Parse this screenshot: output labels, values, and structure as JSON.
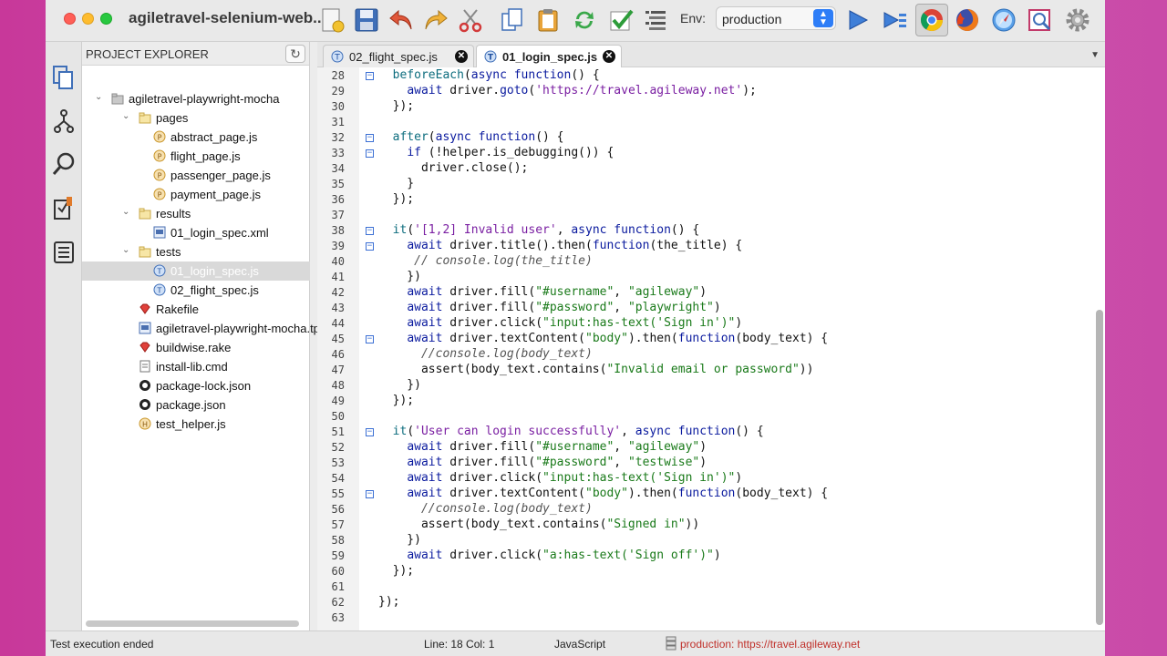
{
  "window": {
    "title": "agiletravel-selenium-web..."
  },
  "toolbar": {
    "env_label": "Env:",
    "env_value": "production",
    "icons": [
      "new-file-icon",
      "save-icon",
      "undo-icon",
      "redo-icon",
      "cut-icon",
      "copy-icon",
      "paste-icon",
      "refresh-icon",
      "check-icon",
      "outline-icon",
      "run-icon",
      "run-all-icon",
      "chrome-icon",
      "firefox-icon",
      "safari-icon",
      "inspect-icon",
      "settings-icon"
    ]
  },
  "explorer": {
    "title": "PROJECT EXPLORER",
    "tree": [
      {
        "label": "agiletravel-playwright-mocha",
        "type": "project",
        "depth": 0,
        "expanded": true
      },
      {
        "label": "pages",
        "type": "folder",
        "depth": 1,
        "expanded": true
      },
      {
        "label": "abstract_page.js",
        "type": "page",
        "depth": 2
      },
      {
        "label": "flight_page.js",
        "type": "page",
        "depth": 2
      },
      {
        "label": "passenger_page.js",
        "type": "page",
        "depth": 2
      },
      {
        "label": "payment_page.js",
        "type": "page",
        "depth": 2
      },
      {
        "label": "results",
        "type": "folder",
        "depth": 1,
        "expanded": true
      },
      {
        "label": "01_login_spec.xml",
        "type": "xml",
        "depth": 2
      },
      {
        "label": "tests",
        "type": "folder",
        "depth": 1,
        "expanded": true
      },
      {
        "label": "01_login_spec.js",
        "type": "test",
        "depth": 2,
        "selected": true
      },
      {
        "label": "02_flight_spec.js",
        "type": "test",
        "depth": 2
      },
      {
        "label": "Rakefile",
        "type": "ruby",
        "depth": 1
      },
      {
        "label": "agiletravel-playwright-mocha.tp",
        "type": "xml",
        "depth": 1
      },
      {
        "label": "buildwise.rake",
        "type": "ruby",
        "depth": 1
      },
      {
        "label": "install-lib.cmd",
        "type": "doc",
        "depth": 1
      },
      {
        "label": "package-lock.json",
        "type": "json",
        "depth": 1
      },
      {
        "label": "package.json",
        "type": "json",
        "depth": 1
      },
      {
        "label": "test_helper.js",
        "type": "helper",
        "depth": 1
      }
    ]
  },
  "tabs": [
    {
      "label": "02_flight_spec.js",
      "active": false
    },
    {
      "label": "01_login_spec.js",
      "active": true
    }
  ],
  "code": [
    {
      "n": "28",
      "fold": true,
      "html": "  <span class='fn'>beforeEach</span>(<span class='kw'>async function</span>() {"
    },
    {
      "n": "29",
      "fold": false,
      "html": "    <span class='kw'>await</span> driver.<span class='kw'>goto</span>(<span class='str'>'https://travel.agileway.net'</span>);"
    },
    {
      "n": "30",
      "fold": false,
      "html": "  });"
    },
    {
      "n": "31",
      "fold": false,
      "html": ""
    },
    {
      "n": "32",
      "fold": true,
      "html": "  <span class='fn'>after</span>(<span class='kw'>async function</span>() {"
    },
    {
      "n": "33",
      "fold": true,
      "html": "    <span class='kw'>if</span> (!helper.is_debugging()) {"
    },
    {
      "n": "34",
      "fold": false,
      "html": "      driver.close();"
    },
    {
      "n": "35",
      "fold": false,
      "html": "    }"
    },
    {
      "n": "36",
      "fold": false,
      "html": "  });"
    },
    {
      "n": "37",
      "fold": false,
      "html": ""
    },
    {
      "n": "38",
      "fold": true,
      "html": "  <span class='fn'>it</span>(<span class='str'>'[1,2] Invalid user'</span>, <span class='kw'>async function</span>() {"
    },
    {
      "n": "39",
      "fold": true,
      "html": "    <span class='kw'>await</span> driver.title().then(<span class='kw'>function</span>(the_title) {"
    },
    {
      "n": "40",
      "fold": false,
      "html": "     <span class='cm'>// console.log(the_title)</span>"
    },
    {
      "n": "41",
      "fold": false,
      "html": "    })"
    },
    {
      "n": "42",
      "fold": false,
      "html": "    <span class='kw'>await</span> driver.fill(<span class='dstr'>\"#username\"</span>, <span class='dstr'>\"agileway\"</span>)"
    },
    {
      "n": "43",
      "fold": false,
      "html": "    <span class='kw'>await</span> driver.fill(<span class='dstr'>\"#password\"</span>, <span class='dstr'>\"playwright\"</span>)"
    },
    {
      "n": "44",
      "fold": false,
      "html": "    <span class='kw'>await</span> driver.click(<span class='dstr'>\"input:has-text('Sign in')\"</span>)"
    },
    {
      "n": "45",
      "fold": true,
      "html": "    <span class='kw'>await</span> driver.textContent(<span class='dstr'>\"body\"</span>).then(<span class='kw'>function</span>(body_text) {"
    },
    {
      "n": "46",
      "fold": false,
      "html": "      <span class='cm'>//console.log(body_text)</span>"
    },
    {
      "n": "47",
      "fold": false,
      "html": "      assert(body_text.contains(<span class='dstr'>\"Invalid email or password\"</span>))"
    },
    {
      "n": "48",
      "fold": false,
      "html": "    })"
    },
    {
      "n": "49",
      "fold": false,
      "html": "  });"
    },
    {
      "n": "50",
      "fold": false,
      "html": ""
    },
    {
      "n": "51",
      "fold": true,
      "html": "  <span class='fn'>it</span>(<span class='str'>'User can login successfully'</span>, <span class='kw'>async function</span>() {"
    },
    {
      "n": "52",
      "fold": false,
      "html": "    <span class='kw'>await</span> driver.fill(<span class='dstr'>\"#username\"</span>, <span class='dstr'>\"agileway\"</span>)"
    },
    {
      "n": "53",
      "fold": false,
      "html": "    <span class='kw'>await</span> driver.fill(<span class='dstr'>\"#password\"</span>, <span class='dstr'>\"testwise\"</span>)"
    },
    {
      "n": "54",
      "fold": false,
      "html": "    <span class='kw'>await</span> driver.click(<span class='dstr'>\"input:has-text('Sign in')\"</span>)"
    },
    {
      "n": "55",
      "fold": true,
      "html": "    <span class='kw'>await</span> driver.textContent(<span class='dstr'>\"body\"</span>).then(<span class='kw'>function</span>(body_text) {"
    },
    {
      "n": "56",
      "fold": false,
      "html": "      <span class='cm'>//console.log(body_text)</span>"
    },
    {
      "n": "57",
      "fold": false,
      "html": "      assert(body_text.contains(<span class='dstr'>\"Signed in\"</span>))"
    },
    {
      "n": "58",
      "fold": false,
      "html": "    })"
    },
    {
      "n": "59",
      "fold": false,
      "html": "    <span class='kw'>await</span> driver.click(<span class='dstr'>\"a:has-text('Sign off')\"</span>)"
    },
    {
      "n": "60",
      "fold": false,
      "html": "  });"
    },
    {
      "n": "61",
      "fold": false,
      "html": ""
    },
    {
      "n": "62",
      "fold": false,
      "html": "});"
    },
    {
      "n": "63",
      "fold": false,
      "html": ""
    }
  ],
  "status": {
    "message": "Test execution ended",
    "position": "Line: 18  Col: 1",
    "language": "JavaScript",
    "environment": "production: https://travel.agileway.net"
  }
}
